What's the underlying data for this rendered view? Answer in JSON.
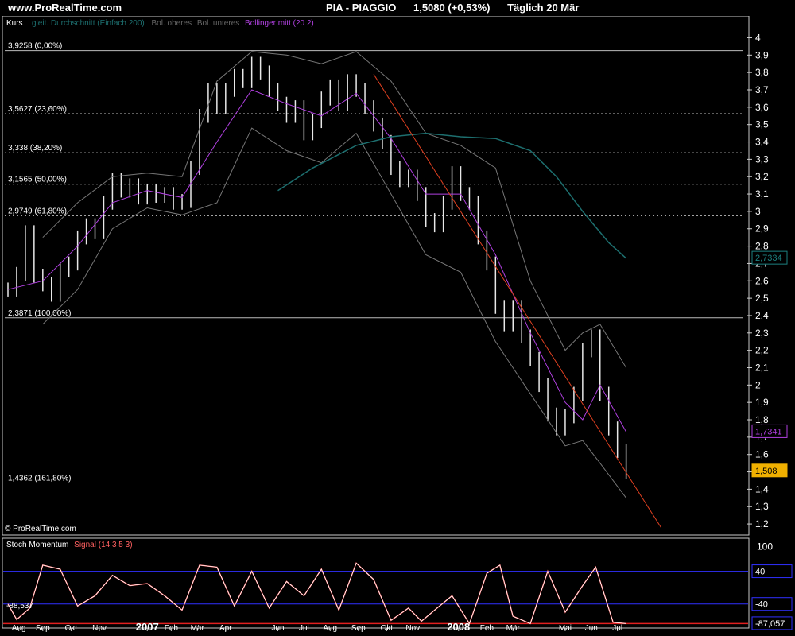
{
  "header": {
    "site": "www.ProRealTime.com",
    "ticker": "PIA - PIAGGIO",
    "price": "1,5080 (+0,53%)",
    "period": "Täglich  20 Mär"
  },
  "main_panel": {
    "title": "Kurs",
    "legend": [
      {
        "text": "gleit. Durchschnitt (Einfach 200)",
        "color": "#1d6f6f"
      },
      {
        "text": "Bol. oberes",
        "color": "#666666"
      },
      {
        "text": "Bol. unteres",
        "color": "#666666"
      },
      {
        "text": "Bollinger mitt (20 2)",
        "color": "#b040e0"
      }
    ],
    "copyright": "© ProRealTime.com",
    "badges": [
      {
        "text": "2,7334",
        "color": "#1d8080"
      },
      {
        "text": "1,7341",
        "color": "#b040e0"
      },
      {
        "text": "1,508",
        "color": "#f0b000"
      }
    ],
    "fib_levels": [
      {
        "label": "3,9258 (0,00%)",
        "value": 3.9258,
        "style": "solid"
      },
      {
        "label": "3,5627 (23,60%)",
        "value": 3.5627,
        "style": "dash"
      },
      {
        "label": "3,338 (38,20%)",
        "value": 3.338,
        "style": "dash"
      },
      {
        "label": "3,1565 (50,00%)",
        "value": 3.1565,
        "style": "dash"
      },
      {
        "label": "2,9749 (61,80%)",
        "value": 2.9749,
        "style": "dash"
      },
      {
        "label": "2,3871 (100,00%)",
        "value": 2.3871,
        "style": "solid"
      },
      {
        "label": "1,4362 (161,80%)",
        "value": 1.4362,
        "style": "dash"
      }
    ]
  },
  "lower_panel": {
    "title": "Stoch Momentum",
    "signal": "Signal (14 3 5 3)",
    "left_value": "-88,537",
    "badges": [
      {
        "text": "40",
        "value": 40
      },
      {
        "text": "-40",
        "value": -40
      },
      {
        "text": "-87,057",
        "value": -87.057
      }
    ]
  },
  "chart_data": {
    "type": "line",
    "price": {
      "ylim": [
        1.15,
        4.08
      ],
      "yticks": [
        "1,2",
        "1,3",
        "1,4",
        "1,5",
        "1,6",
        "1,7",
        "1,8",
        "1,9",
        "2",
        "2,1",
        "2,2",
        "2,3",
        "2,4",
        "2,5",
        "2,6",
        "2,7",
        "2,8",
        "2,9",
        "3",
        "3,1",
        "3,2",
        "3,3",
        "3,4",
        "3,5",
        "3,6",
        "3,7",
        "3,8",
        "3,9",
        "4"
      ],
      "ytick_values": [
        1.2,
        1.3,
        1.4,
        1.5,
        1.6,
        1.7,
        1.8,
        1.9,
        2.0,
        2.1,
        2.2,
        2.3,
        2.4,
        2.5,
        2.6,
        2.7,
        2.8,
        2.9,
        3.0,
        3.1,
        3.2,
        3.3,
        3.4,
        3.5,
        3.6,
        3.7,
        3.8,
        3.9,
        4.0
      ],
      "close": [
        [
          0,
          2.55
        ],
        [
          4,
          2.64
        ],
        [
          8,
          2.88
        ],
        [
          12,
          2.63
        ],
        [
          16,
          2.58
        ],
        [
          20,
          2.52
        ],
        [
          24,
          2.66
        ],
        [
          28,
          2.7
        ],
        [
          32,
          2.85
        ],
        [
          36,
          2.92
        ],
        [
          40,
          2.88
        ],
        [
          44,
          3.05
        ],
        [
          48,
          3.18
        ],
        [
          52,
          3.12
        ],
        [
          56,
          3.15
        ],
        [
          60,
          3.08
        ],
        [
          64,
          3.12
        ],
        [
          68,
          3.09
        ],
        [
          72,
          3.1
        ],
        [
          76,
          3.05
        ],
        [
          80,
          3.06
        ],
        [
          84,
          3.25
        ],
        [
          88,
          3.55
        ],
        [
          92,
          3.7
        ],
        [
          96,
          3.6
        ],
        [
          100,
          3.7
        ],
        [
          104,
          3.78
        ],
        [
          108,
          3.75
        ],
        [
          112,
          3.85
        ],
        [
          116,
          3.8
        ],
        [
          120,
          3.7
        ],
        [
          124,
          3.62
        ],
        [
          128,
          3.55
        ],
        [
          132,
          3.6
        ],
        [
          136,
          3.45
        ],
        [
          140,
          3.52
        ],
        [
          144,
          3.65
        ],
        [
          148,
          3.72
        ],
        [
          152,
          3.62
        ],
        [
          156,
          3.75
        ],
        [
          160,
          3.7
        ],
        [
          164,
          3.6
        ],
        [
          168,
          3.5
        ],
        [
          172,
          3.4
        ],
        [
          176,
          3.25
        ],
        [
          180,
          3.18
        ],
        [
          184,
          3.2
        ],
        [
          188,
          3.1
        ],
        [
          192,
          2.95
        ],
        [
          196,
          2.92
        ],
        [
          200,
          3.05
        ],
        [
          204,
          3.22
        ],
        [
          208,
          3.1
        ],
        [
          212,
          3.05
        ],
        [
          216,
          2.85
        ],
        [
          220,
          2.7
        ],
        [
          224,
          2.45
        ],
        [
          228,
          2.35
        ],
        [
          232,
          2.45
        ],
        [
          236,
          2.28
        ],
        [
          240,
          2.15
        ],
        [
          244,
          2.0
        ],
        [
          248,
          1.83
        ],
        [
          252,
          1.75
        ],
        [
          256,
          1.82
        ],
        [
          260,
          1.95
        ],
        [
          264,
          2.2
        ],
        [
          268,
          2.28
        ],
        [
          272,
          1.95
        ],
        [
          276,
          1.75
        ],
        [
          280,
          1.62
        ],
        [
          284,
          1.5
        ]
      ],
      "sma200": [
        [
          124,
          3.12
        ],
        [
          140,
          3.25
        ],
        [
          160,
          3.38
        ],
        [
          176,
          3.43
        ],
        [
          192,
          3.45
        ],
        [
          208,
          3.43
        ],
        [
          224,
          3.42
        ],
        [
          240,
          3.35
        ],
        [
          252,
          3.2
        ],
        [
          264,
          3.0
        ],
        [
          276,
          2.82
        ],
        [
          284,
          2.73
        ]
      ],
      "boll_mid": [
        [
          0,
          2.55
        ],
        [
          16,
          2.6
        ],
        [
          32,
          2.8
        ],
        [
          48,
          3.05
        ],
        [
          64,
          3.12
        ],
        [
          80,
          3.08
        ],
        [
          96,
          3.4
        ],
        [
          112,
          3.7
        ],
        [
          128,
          3.62
        ],
        [
          144,
          3.55
        ],
        [
          160,
          3.68
        ],
        [
          176,
          3.42
        ],
        [
          192,
          3.1
        ],
        [
          208,
          3.1
        ],
        [
          224,
          2.75
        ],
        [
          240,
          2.3
        ],
        [
          256,
          1.9
        ],
        [
          264,
          1.8
        ],
        [
          272,
          2.0
        ],
        [
          284,
          1.73
        ]
      ],
      "boll_up": [
        [
          16,
          2.85
        ],
        [
          32,
          3.05
        ],
        [
          48,
          3.2
        ],
        [
          64,
          3.22
        ],
        [
          80,
          3.2
        ],
        [
          96,
          3.75
        ],
        [
          112,
          3.92
        ],
        [
          128,
          3.9
        ],
        [
          144,
          3.85
        ],
        [
          160,
          3.92
        ],
        [
          176,
          3.75
        ],
        [
          192,
          3.45
        ],
        [
          208,
          3.38
        ],
        [
          224,
          3.25
        ],
        [
          240,
          2.6
        ],
        [
          256,
          2.2
        ],
        [
          264,
          2.3
        ],
        [
          272,
          2.35
        ],
        [
          284,
          2.1
        ]
      ],
      "boll_low": [
        [
          16,
          2.35
        ],
        [
          32,
          2.55
        ],
        [
          48,
          2.9
        ],
        [
          64,
          3.02
        ],
        [
          80,
          2.98
        ],
        [
          96,
          3.05
        ],
        [
          112,
          3.48
        ],
        [
          128,
          3.35
        ],
        [
          144,
          3.28
        ],
        [
          160,
          3.45
        ],
        [
          176,
          3.1
        ],
        [
          192,
          2.75
        ],
        [
          208,
          2.65
        ],
        [
          224,
          2.25
        ],
        [
          240,
          1.95
        ],
        [
          256,
          1.65
        ],
        [
          264,
          1.68
        ],
        [
          272,
          1.55
        ],
        [
          284,
          1.35
        ]
      ],
      "trendline": [
        [
          168,
          3.79
        ],
        [
          300,
          1.18
        ]
      ]
    },
    "oscillator": {
      "ylim": [
        -95,
        115
      ],
      "yticks": [
        "100"
      ],
      "ytick_values": [
        100
      ],
      "hlines": [
        40,
        -40
      ],
      "series": [
        [
          0,
          -40
        ],
        [
          4,
          -78
        ],
        [
          10,
          -50
        ],
        [
          16,
          55
        ],
        [
          24,
          45
        ],
        [
          32,
          -45
        ],
        [
          40,
          -20
        ],
        [
          48,
          30
        ],
        [
          56,
          5
        ],
        [
          64,
          10
        ],
        [
          72,
          -20
        ],
        [
          80,
          -55
        ],
        [
          88,
          55
        ],
        [
          96,
          50
        ],
        [
          104,
          -45
        ],
        [
          112,
          40
        ],
        [
          120,
          -50
        ],
        [
          128,
          15
        ],
        [
          136,
          -20
        ],
        [
          144,
          45
        ],
        [
          152,
          -55
        ],
        [
          160,
          60
        ],
        [
          168,
          20
        ],
        [
          176,
          -80
        ],
        [
          184,
          -50
        ],
        [
          190,
          -82
        ],
        [
          196,
          -55
        ],
        [
          204,
          -20
        ],
        [
          212,
          -88
        ],
        [
          220,
          35
        ],
        [
          226,
          55
        ],
        [
          232,
          -70
        ],
        [
          240,
          -88
        ],
        [
          248,
          40
        ],
        [
          256,
          -60
        ],
        [
          264,
          5
        ],
        [
          270,
          50
        ],
        [
          278,
          -85
        ],
        [
          284,
          -88
        ]
      ]
    },
    "x_axis": {
      "domain": [
        0,
        336
      ],
      "labels": [
        {
          "text": "Aug",
          "x": 5
        },
        {
          "text": "Sep",
          "x": 16
        },
        {
          "text": "Okt",
          "x": 29
        },
        {
          "text": "Nov",
          "x": 42
        },
        {
          "text": "2007",
          "x": 64,
          "bold": true
        },
        {
          "text": "Feb",
          "x": 75
        },
        {
          "text": "Mär",
          "x": 87
        },
        {
          "text": "Apr",
          "x": 100
        },
        {
          "text": "Jun",
          "x": 124
        },
        {
          "text": "Jul",
          "x": 136
        },
        {
          "text": "Aug",
          "x": 148
        },
        {
          "text": "Sep",
          "x": 161
        },
        {
          "text": "Okt",
          "x": 174
        },
        {
          "text": "Nov",
          "x": 186
        },
        {
          "text": "2008",
          "x": 207,
          "bold": true
        },
        {
          "text": "Feb",
          "x": 220
        },
        {
          "text": "Mär",
          "x": 232
        },
        {
          "text": "Mai",
          "x": 256
        },
        {
          "text": "Jun",
          "x": 268
        },
        {
          "text": "Jul",
          "x": 280
        }
      ]
    }
  }
}
